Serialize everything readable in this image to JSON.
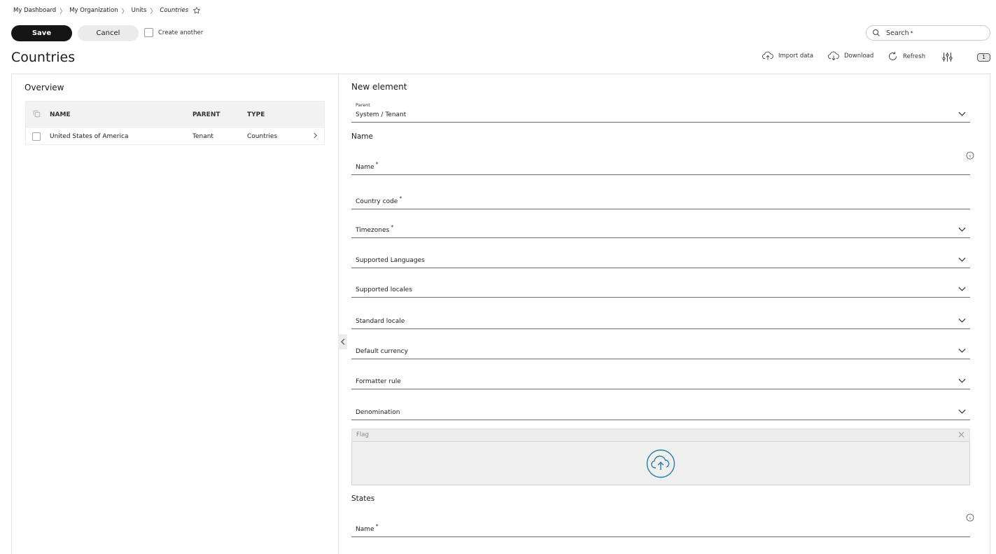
{
  "breadcrumb": {
    "items": [
      "My Dashboard",
      "My Organization",
      "Units",
      "Countries"
    ]
  },
  "toolbar": {
    "save_label": "Save",
    "cancel_label": "Cancel",
    "create_another_label": "Create another",
    "search_placeholder": "Search",
    "search_required_mark": "*"
  },
  "page": {
    "title": "Countries",
    "actions": {
      "import_label": "Import data",
      "download_label": "Download",
      "refresh_label": "Refresh"
    },
    "badge": "1"
  },
  "overview": {
    "title": "Overview",
    "columns": [
      "NAME",
      "PARENT",
      "TYPE"
    ],
    "rows": [
      {
        "name": "United States of America",
        "parent": "Tenant",
        "type": "Countries"
      }
    ]
  },
  "form": {
    "title": "New element",
    "parent": {
      "label": "Parent",
      "value": "System / Tenant"
    },
    "name_section": "Name",
    "fields": {
      "name": "Name",
      "country_code": "Country code",
      "timezones": "Timezones",
      "supported_languages": "Supported Languages",
      "supported_locales": "Supported locales",
      "standard_locale": "Standard locale",
      "default_currency": "Default currency",
      "formatter_rule": "Formatter rule",
      "denomination": "Denomination"
    },
    "required_mark": "*",
    "flag_label": "Flag",
    "states_section": "States",
    "states_name": "Name"
  },
  "colors": {
    "primary_button": "#151515",
    "upload_accent": "#2b7fa0",
    "border": "#e2e2e2"
  },
  "icons": {
    "favorite": "star-icon",
    "search": "search-icon",
    "import": "cloud-upload-icon",
    "download": "cloud-download-icon",
    "refresh": "refresh-icon",
    "settings": "sliders-icon",
    "collapse": "chevron-left-icon",
    "dropdown": "chevron-down-icon",
    "info": "info-icon",
    "close": "close-icon",
    "upload": "cloud-upload-icon"
  }
}
